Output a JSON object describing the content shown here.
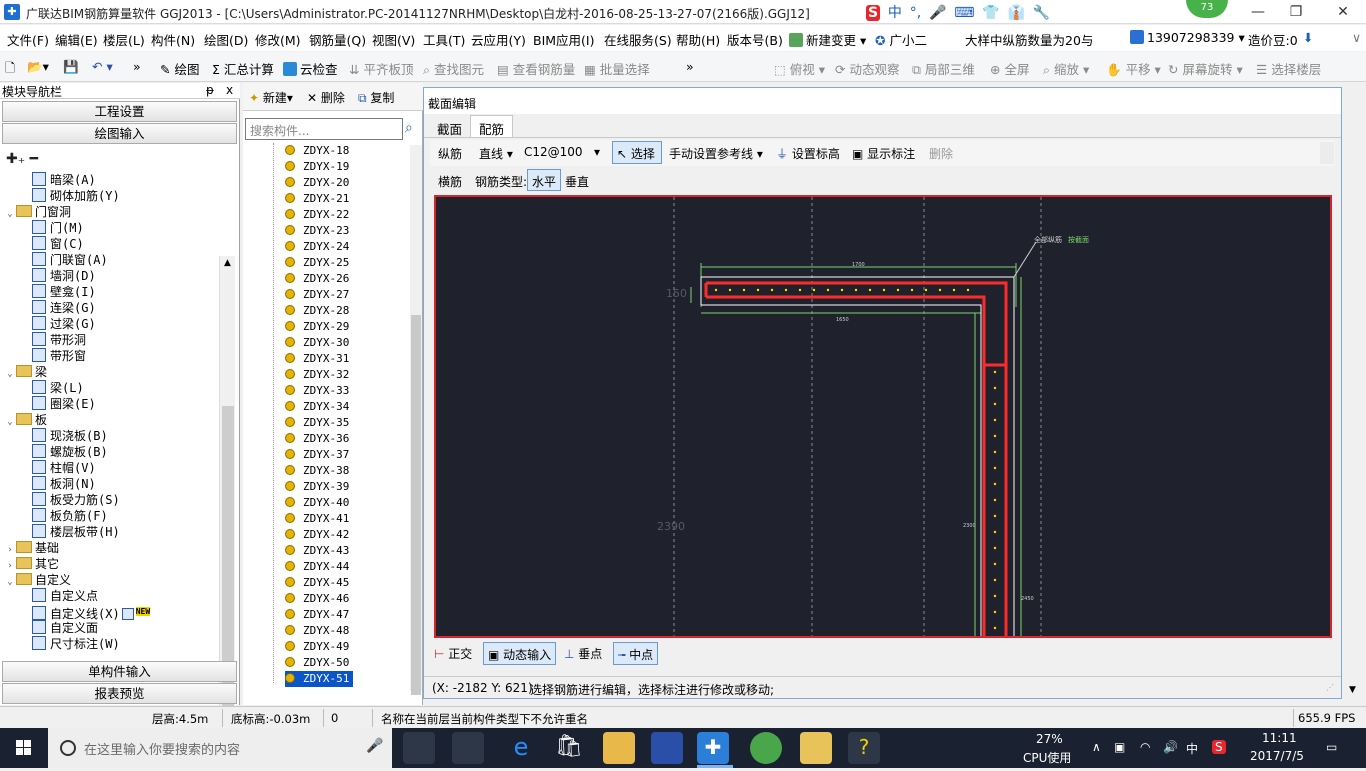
{
  "window": {
    "title": "广联达BIM钢筋算量软件 GGJ2013 - [C:\\Users\\Administrator.PC-20141127NRHM\\Desktop\\白龙村-2016-08-25-13-27-07(2166版).GGJ12]",
    "badge": "73",
    "ime": [
      "中",
      "°,",
      "🎤",
      "⌨",
      "👕",
      "👔",
      "🔧"
    ]
  },
  "menubar": {
    "items": [
      "文件(F)",
      "编辑(E)",
      "楼层(L)",
      "构件(N)",
      "绘图(D)",
      "修改(M)",
      "钢筋量(Q)",
      "视图(V)",
      "工具(T)",
      "云应用(Y)",
      "BIM应用(I)",
      "在线服务(S)",
      "帮助(H)",
      "版本号(B)"
    ],
    "new_change": "新建变更",
    "assistant": "广小二",
    "marquee": "大样中纵筋数量为20与",
    "phone": "13907298339",
    "cost": "造价豆:0"
  },
  "toolbar": {
    "draw": "绘图",
    "sum": "汇总计算",
    "cloud_check": "云检查",
    "align_slab": "平齐板顶",
    "find_elem": "查找图元",
    "view_rebar": "查看钢筋量",
    "batch_select": "批量选择",
    "view_mode": "二维",
    "top_view": "俯视",
    "dyn_view": "动态观察",
    "local_3d": "局部三维",
    "fullscreen": "全屏",
    "zoom": "缩放",
    "pan": "平移",
    "rotate": "屏幕旋转",
    "select_floor": "选择楼层"
  },
  "nav": {
    "title": "模块导航栏",
    "pin": "ᵽ x",
    "btn_project": "工程设置",
    "btn_draw": "绘图输入",
    "btn_single": "单构件输入",
    "btn_report": "报表预览",
    "tree": [
      {
        "label": "暗梁(A)",
        "level": 2
      },
      {
        "label": "砌体加筋(Y)",
        "level": 2
      },
      {
        "label": "门窗洞",
        "level": 1,
        "folder": true
      },
      {
        "label": "门(M)",
        "level": 2
      },
      {
        "label": "窗(C)",
        "level": 2
      },
      {
        "label": "门联窗(A)",
        "level": 2
      },
      {
        "label": "墙洞(D)",
        "level": 2
      },
      {
        "label": "壁龛(I)",
        "level": 2
      },
      {
        "label": "连梁(G)",
        "level": 2
      },
      {
        "label": "过梁(G)",
        "level": 2
      },
      {
        "label": "带形洞",
        "level": 2
      },
      {
        "label": "带形窗",
        "level": 2
      },
      {
        "label": "梁",
        "level": 1,
        "folder": true
      },
      {
        "label": "梁(L)",
        "level": 2
      },
      {
        "label": "圈梁(E)",
        "level": 2
      },
      {
        "label": "板",
        "level": 1,
        "folder": true
      },
      {
        "label": "现浇板(B)",
        "level": 2
      },
      {
        "label": "螺旋板(B)",
        "level": 2
      },
      {
        "label": "柱帽(V)",
        "level": 2
      },
      {
        "label": "板洞(N)",
        "level": 2
      },
      {
        "label": "板受力筋(S)",
        "level": 2
      },
      {
        "label": "板负筋(F)",
        "level": 2
      },
      {
        "label": "楼层板带(H)",
        "level": 2
      },
      {
        "label": "基础",
        "level": 1,
        "folder": true,
        "collapsed": true
      },
      {
        "label": "其它",
        "level": 1,
        "folder": true,
        "collapsed": true
      },
      {
        "label": "自定义",
        "level": 1,
        "folder": true
      },
      {
        "label": "自定义点",
        "level": 2
      },
      {
        "label": "自定义线(X)",
        "level": 2,
        "new": "NEW"
      },
      {
        "label": "自定义面",
        "level": 2
      },
      {
        "label": "尺寸标注(W)",
        "level": 2
      }
    ]
  },
  "components": {
    "new": "新建",
    "delete": "删除",
    "copy": "复制",
    "search_placeholder": "搜索构件...",
    "items": [
      "ZDYX-18",
      "ZDYX-19",
      "ZDYX-20",
      "ZDYX-21",
      "ZDYX-22",
      "ZDYX-23",
      "ZDYX-24",
      "ZDYX-25",
      "ZDYX-26",
      "ZDYX-27",
      "ZDYX-28",
      "ZDYX-29",
      "ZDYX-30",
      "ZDYX-31",
      "ZDYX-32",
      "ZDYX-33",
      "ZDYX-34",
      "ZDYX-35",
      "ZDYX-36",
      "ZDYX-37",
      "ZDYX-38",
      "ZDYX-39",
      "ZDYX-40",
      "ZDYX-41",
      "ZDYX-42",
      "ZDYX-43",
      "ZDYX-44",
      "ZDYX-45",
      "ZDYX-46",
      "ZDYX-47",
      "ZDYX-48",
      "ZDYX-49",
      "ZDYX-50",
      "ZDYX-51"
    ],
    "selected": "ZDYX-51"
  },
  "dialog": {
    "title": "截面编辑",
    "tabs": [
      "截面",
      "配筋"
    ],
    "active_tab": "配筋",
    "row1": {
      "long_bar": "纵筋",
      "line_type": "直线",
      "spec": "C12@100",
      "select": "选择",
      "ref_line": "手动设置参考线",
      "set_elev": "设置标高",
      "show_dim": "显示标注",
      "delete": "删除"
    },
    "row2": {
      "hbar": "横筋",
      "type_label": "钢筋类型:",
      "horizontal": "水平",
      "vertical": "垂直"
    },
    "canvas": {
      "dim_left_150": "150",
      "dim_2390": "2390",
      "label_all_long": "全部纵筋",
      "label_green": "按截面",
      "dim_top": "1700",
      "dim_mid": "1650",
      "dim_right": "2300",
      "dim_bottom": "2450"
    },
    "snap": {
      "ortho": "正交",
      "dyn_input": "动态输入",
      "perp": "垂点",
      "mid": "中点"
    },
    "coords": "(X: -2182 Y: 621)",
    "hint": "选择钢筋进行编辑，选择标注进行修改或移动;"
  },
  "statusbar": {
    "floor_h": "层高:4.5m",
    "base_h": "底标高:-0.03m",
    "zero": "0",
    "msg": "名称在当前层当前构件类型下不允许重名",
    "fps": "655.9 FPS"
  },
  "taskbar": {
    "search_placeholder": "在这里输入你要搜索的内容",
    "cpu_pct": "27%",
    "cpu_label": "CPU使用",
    "lang": "中",
    "time": "11:11",
    "date": "2017/7/5"
  },
  "colors": {
    "accent": "#0a55c8",
    "canvas_bg": "#1f222d",
    "rebar_red": "#d8242a",
    "dim_green": "#7dd36a"
  }
}
